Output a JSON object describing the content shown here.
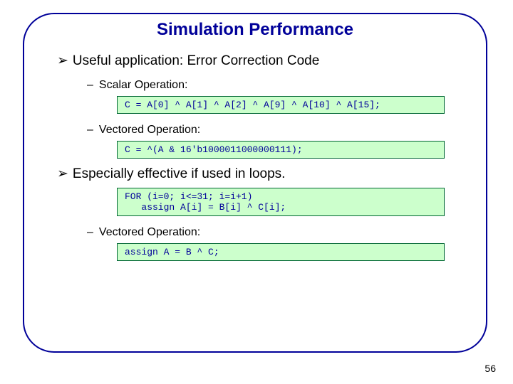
{
  "title": "Simulation Performance",
  "bullet1a": "Useful application: Error Correction Code",
  "sub1": "Scalar Operation:",
  "code1": "C = A[0] ^ A[1] ^ A[2] ^ A[9] ^ A[10] ^ A[15];",
  "sub2": "Vectored Operation:",
  "code2": "C = ^(A & 16'b1000011000000111);",
  "bullet1b": "Especially effective if used in loops.",
  "code3": "FOR (i=0; i<=31; i=i+1)\n   assign A[i] = B[i] ^ C[i];",
  "sub3": "Vectored Operation:",
  "code4": "assign A = B ^ C;",
  "pagenum": "56",
  "glyphs": {
    "arrow": "➢",
    "dash": "–"
  }
}
